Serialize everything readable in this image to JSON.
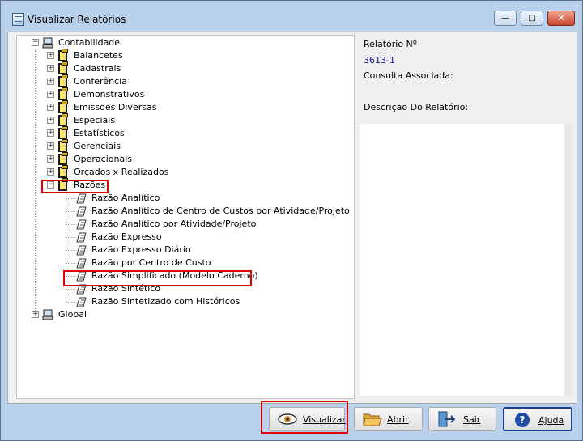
{
  "window": {
    "title": "Visualizar Relatórios"
  },
  "tree": {
    "root1": "Contabilidade",
    "folders": [
      "Balancetes",
      "Cadastrais",
      "Conferência",
      "Demonstrativos",
      "Emissões Diversas",
      "Especiais",
      "Estatísticos",
      "Gerenciais",
      "Operacionais",
      "Orçados x Realizados"
    ],
    "expanded_folder": "Razões",
    "reports": [
      "Razão Analítico",
      "Razão Analítico de Centro de Custos por Atividade/Projeto",
      "Razão Analítico por Atividade/Projeto",
      "Razão Expresso",
      "Razão Expresso Diário",
      "Razão por Centro de Custo",
      "Razão Simplificado (Modelo Caderno)",
      "Razão Sintético",
      "Razão Sintetizado com Históricos"
    ],
    "root2": "Global"
  },
  "side": {
    "report_no_label": "Relatório Nº",
    "report_no_value": "3613-1",
    "assoc_label": "Consulta Associada:",
    "desc_label": "Descrição Do Relatório:"
  },
  "buttons": {
    "visualizar": "Visualizar",
    "abrir": "Abrir",
    "sair": "Sair",
    "ajuda": "Ajuda"
  },
  "colors": {
    "highlight_box": "#e00000",
    "report_no": "#1a1aa0"
  }
}
